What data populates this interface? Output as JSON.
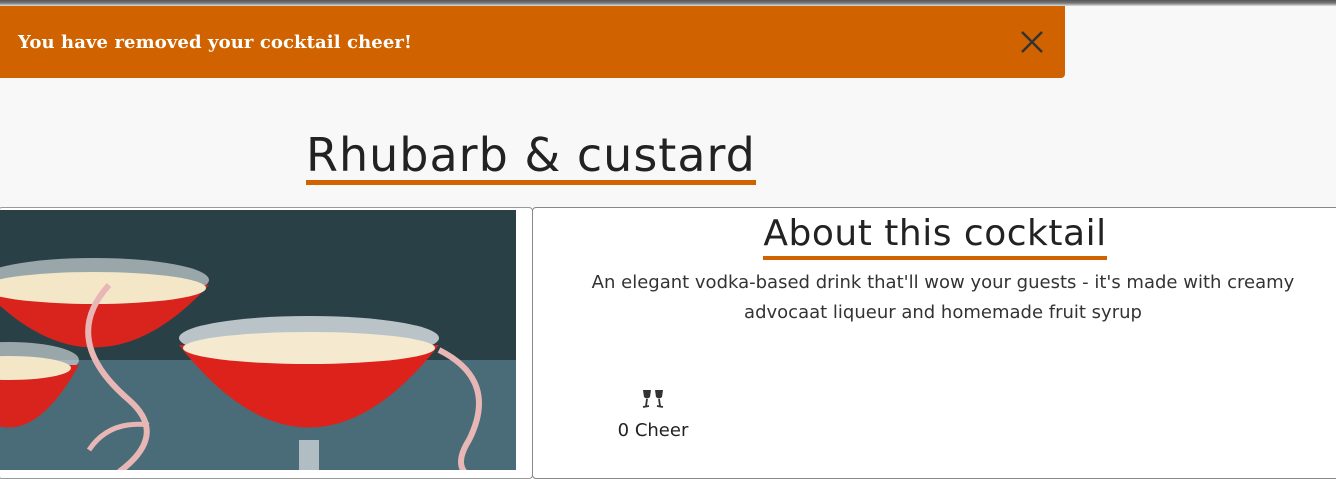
{
  "toast": {
    "message": "You have removed your cocktail cheer!",
    "close_icon": "close-icon"
  },
  "cocktail": {
    "name": "Rhubarb & custard",
    "image_alt": "rhubarb-custard-cocktail-photo"
  },
  "about": {
    "heading": "About this cocktail",
    "description": "An elegant vodka-based drink that'll wow your guests - it's made with creamy advocaat liqueur and homemade fruit syrup"
  },
  "cheer": {
    "icon": "clinking-glasses-icon",
    "label": "0 Cheer"
  },
  "colors": {
    "accent": "#d06200",
    "toast_text": "#ffffff"
  }
}
